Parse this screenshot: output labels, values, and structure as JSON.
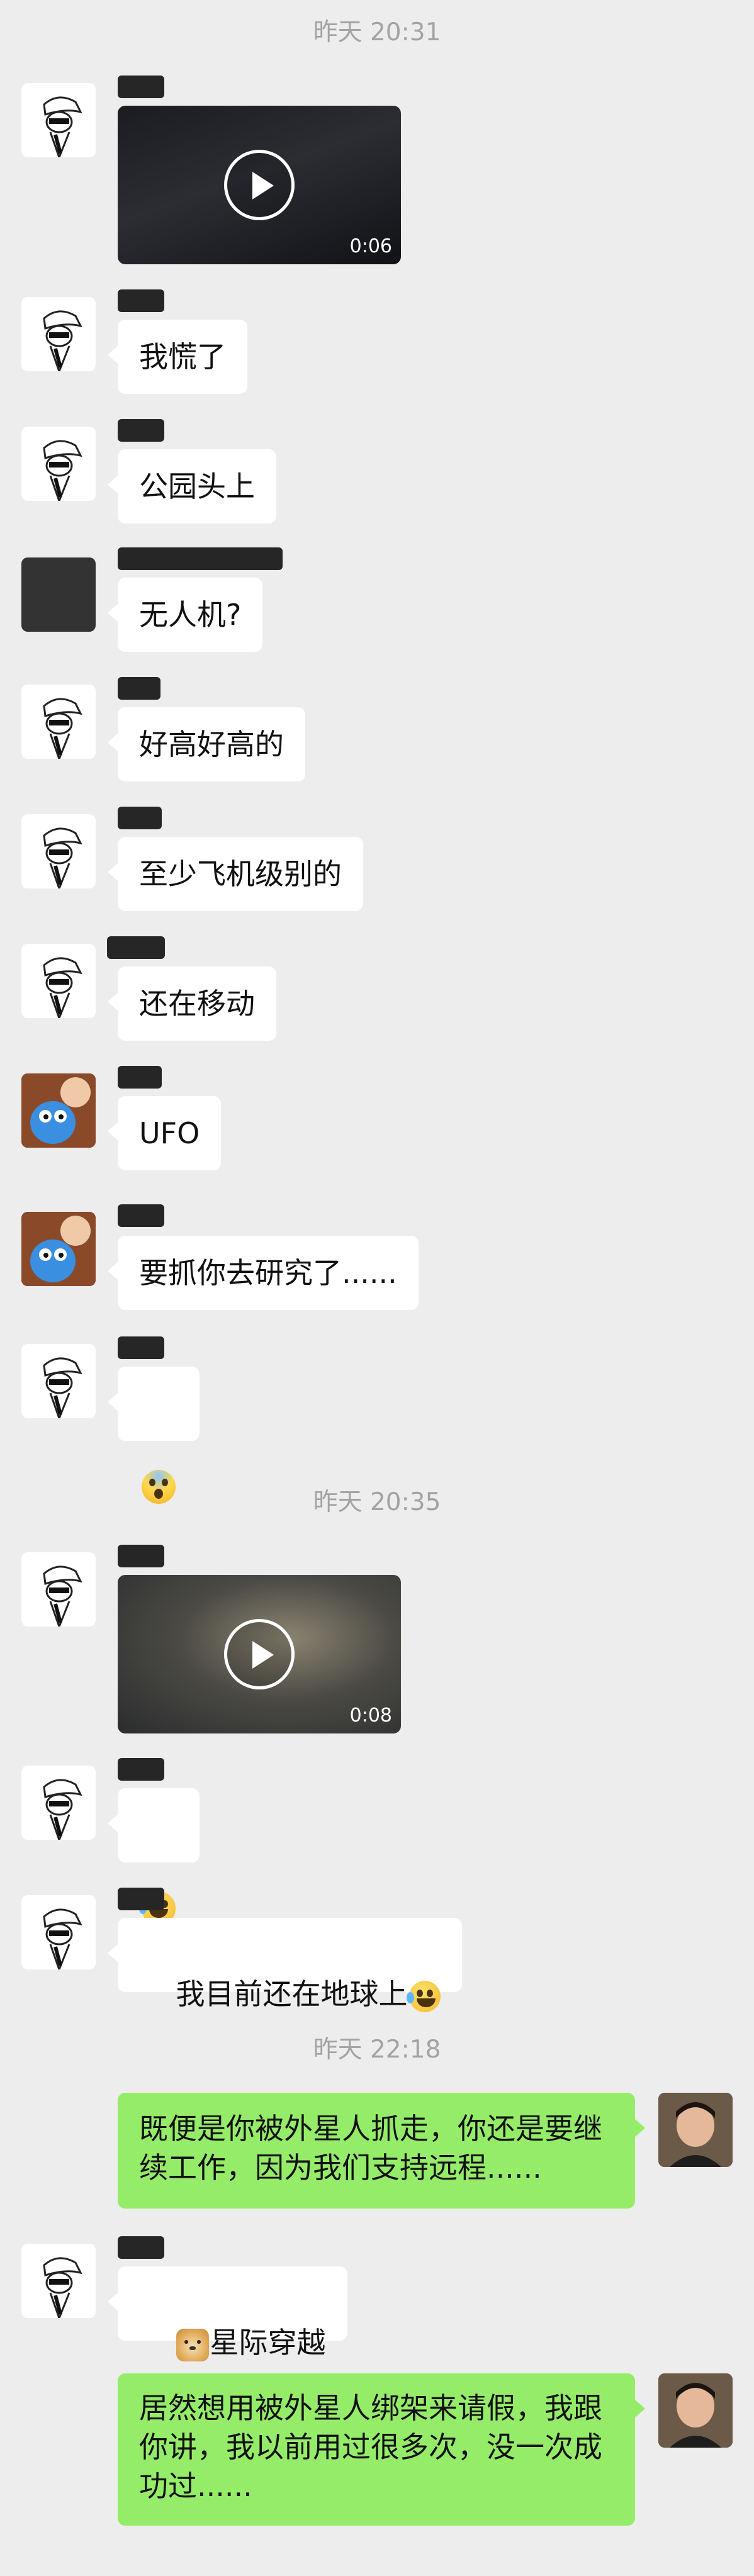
{
  "chat": {
    "timestamps": [
      "昨天 20:31",
      "昨天 20:35",
      "昨天 22:18"
    ],
    "messages": [
      {
        "type": "video",
        "duration": "0:06"
      },
      {
        "type": "text",
        "text": "我慌了"
      },
      {
        "type": "text",
        "text": "公园头上"
      },
      {
        "type": "text",
        "text": "无人机?"
      },
      {
        "type": "text",
        "text": "好高好高的"
      },
      {
        "type": "text",
        "text": "至少飞机级别的"
      },
      {
        "type": "text",
        "text": "还在移动"
      },
      {
        "type": "text",
        "text": "UFO"
      },
      {
        "type": "text",
        "text": "要抓你去研究了......"
      },
      {
        "type": "emoji",
        "icon": "screaming-face-icon"
      },
      {
        "type": "video",
        "duration": "0:08"
      },
      {
        "type": "emoji",
        "icon": "rolling-laughing-face-icon"
      },
      {
        "type": "text",
        "text": "我目前还在地球上",
        "icon": "rolling-laughing-face-icon"
      },
      {
        "type": "text",
        "text": "既便是你被外星人抓走，你还是要继续工作，因为我们支持远程......"
      },
      {
        "type": "text",
        "text": "星际穿越",
        "icon": "doge-icon"
      },
      {
        "type": "text",
        "text": "居然想用被外星人绑架来请假，我跟你讲，我以前用过很多次，没一次成功过......"
      }
    ]
  },
  "colors": {
    "background": "#ededed",
    "incoming_bubble": "#ffffff",
    "outgoing_bubble": "#95ec69",
    "timestamp_text": "#a3a3a3"
  }
}
